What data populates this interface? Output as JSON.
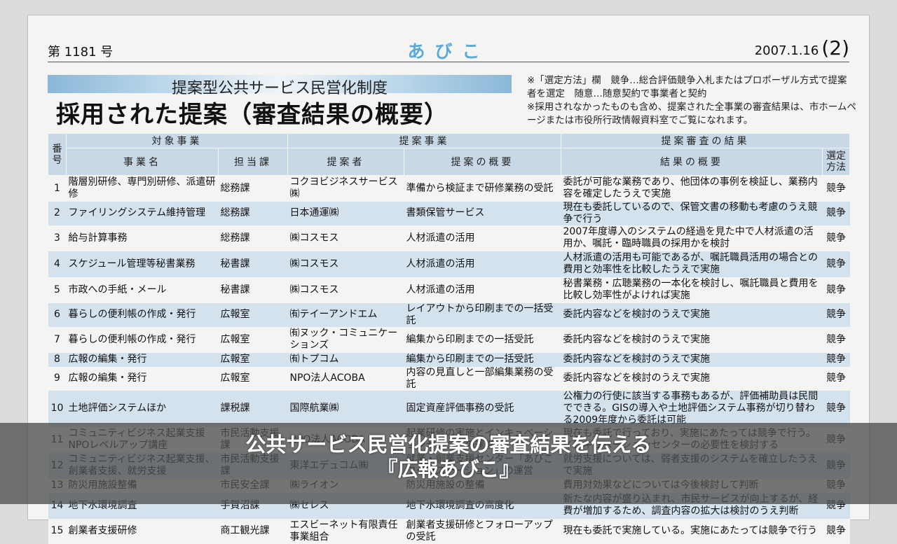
{
  "header": {
    "issue": "第 1181 号",
    "logo": "あびこ",
    "date": "2007.1.16",
    "page": "(2)"
  },
  "banner": {
    "subtitle": "提案型公共サービス民営化制度",
    "title": "採用された提案（審査結果の概要）"
  },
  "notes": [
    "※「選定方法」欄　競争…総合評価競争入札またはプロポーザル方式で提案者を選定　随意…随意契約で事業者と契約",
    "※採用されなかったものも含め、提案された全事業の審査結果は、市ホームページまたは市役所行政情報資料室でご覧になれます。"
  ],
  "table": {
    "group_headers": {
      "number": "番号",
      "target": "対象事業",
      "proposal": "提案事業",
      "review": "提案審査の結果"
    },
    "columns": {
      "name": "事業名",
      "dept": "担当課",
      "proposer": "提案者",
      "summary": "提案の概要",
      "result": "結果の概要",
      "method": "選定方法"
    },
    "rows": [
      {
        "no": "1",
        "name": "階層別研修、専門別研修、派遣研修",
        "dept": "総務課",
        "proposer": "コクヨビジネスサービス㈱",
        "summary": "準備から検証まで研修業務の受託",
        "result": "委託が可能な業務であり、他団体の事例を検証し、業務内容を確定したうえで実施",
        "method": "競争"
      },
      {
        "no": "2",
        "name": "ファイリングシステム維持管理",
        "dept": "総務課",
        "proposer": "日本通運㈱",
        "summary": "書類保管サービス",
        "result": "現在も委託しているので、保管文書の移動も考慮のうえ競争で行う",
        "method": "競争"
      },
      {
        "no": "3",
        "name": "給与計算事務",
        "dept": "総務課",
        "proposer": "㈱コスモス",
        "summary": "人材派遣の活用",
        "result": "2007年度導入のシステムの経過を見た中で人材派遣の活用か、嘱託・臨時職員の採用かを検討",
        "method": "競争"
      },
      {
        "no": "4",
        "name": "スケジュール管理等秘書業務",
        "dept": "秘書課",
        "proposer": "㈱コスモス",
        "summary": "人材派遣の活用",
        "result": "人材派遣の活用も可能であるが、嘱託職員活用の場合との費用と効率性を比較したうえで実施",
        "method": "競争"
      },
      {
        "no": "5",
        "name": "市政への手紙・メール",
        "dept": "秘書課",
        "proposer": "㈱コスモス",
        "summary": "人材派遣の活用",
        "result": "秘書業務・広聴業務の一本化を検討し、嘱託職員と費用を比較し効率性がよければ実施",
        "method": "競争"
      },
      {
        "no": "6",
        "name": "暮らしの便利帳の作成・発行",
        "dept": "広報室",
        "proposer": "㈲テイーアンドエム",
        "summary": "レイアウトから印刷までの一括受託",
        "result": "委託内容などを検討のうえで実施",
        "method": "競争"
      },
      {
        "no": "7",
        "name": "暮らしの便利帳の作成・発行",
        "dept": "広報室",
        "proposer": "㈲ヌック・コミュニケーションズ",
        "summary": "編集から印刷までの一括受託",
        "result": "委託内容などを検討のうえで実施",
        "method": "競争"
      },
      {
        "no": "8",
        "name": "広報の編集・発行",
        "dept": "広報室",
        "proposer": "㈲トプコム",
        "summary": "編集から印刷までの一括受託",
        "result": "委託内容などを検討のうえで実施",
        "method": "競争"
      },
      {
        "no": "9",
        "name": "広報の編集・発行",
        "dept": "広報室",
        "proposer": "NPO法人ACOBA",
        "summary": "内容の見直しと一部編集業務の受託",
        "result": "委託内容などを検討のうえで実施",
        "method": "競争"
      },
      {
        "no": "10",
        "name": "土地評価システムほか",
        "dept": "課税課",
        "proposer": "国際航業㈱",
        "summary": "固定資産評価事務の受託",
        "result": "公権力の行使に該当する事務もあるが、評価補助員は民間でできる。GISの導入や土地評価システム事務が切り替わる2009年度から委託は可能",
        "method": "競争"
      },
      {
        "no": "11",
        "name": "コミュニティビジネス起業支援 NPOレベルアップ講座",
        "dept": "市民活動支援課",
        "proposer": "NPO法人ACOBA",
        "summary": "起業研修の実施とインキュベーションセンターの運営",
        "result": "現在も委託で行っており、実施にあたっては競争で行う。インキュベーションセンターの必要性を検討する",
        "method": "競争"
      },
      {
        "no": "12",
        "name": "コミュニティビジネス起業支援、創業者支援、就労支援",
        "dept": "市民活動支援課",
        "proposer": "東洋エデュコム㈱",
        "summary": "就業・創業支援センター「あびこワークステーション」の運営",
        "result": "就労支援については、弱者支援のシステムを確立したうえで実施",
        "method": "競争"
      },
      {
        "no": "13",
        "name": "防災用施設整備",
        "dept": "市民安全課",
        "proposer": "㈱ライオン",
        "summary": "防災用施設の整備",
        "result": "費用対効果などについては今後検討して判断",
        "method": "競争"
      },
      {
        "no": "14",
        "name": "地下水環境調査",
        "dept": "手賀沼課",
        "proposer": "㈱セレス",
        "summary": "地下水環境調査の高度化",
        "result": "新たな内容が盛り込まれ、市民サービスが向上するが、経費が増加するため、調査内容の拡大は検討のうえ判断",
        "method": "競争"
      },
      {
        "no": "15",
        "name": "創業者支援研修",
        "dept": "商工観光課",
        "proposer": "エスビーネット有限責任事業組合",
        "summary": "創業者支援研修とフォローアップの受託",
        "result": "現在も委託で実施している。実施にあたっては競争で行う",
        "method": "競争"
      }
    ]
  },
  "caption": {
    "line1": "公共サービス民営化提案の審査結果を伝える",
    "line2": "『広報あびこ』"
  }
}
